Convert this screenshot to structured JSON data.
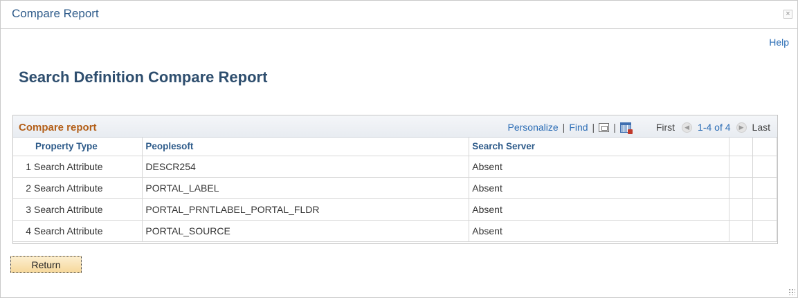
{
  "window": {
    "title": "Compare Report",
    "close_label": "×"
  },
  "help_label": "Help",
  "page_title": "Search Definition Compare Report",
  "grid": {
    "caption": "Compare report",
    "nav": {
      "personalize": "Personalize",
      "find": "Find",
      "first": "First",
      "range": "1-4 of 4",
      "last": "Last",
      "sep": "|"
    },
    "columns": [
      "Property Type",
      "Peoplesoft",
      "Search Server"
    ],
    "rows": [
      {
        "num": "1",
        "property_type": "Search Attribute",
        "peoplesoft": "DESCR254",
        "search_server": "Absent"
      },
      {
        "num": "2",
        "property_type": "Search Attribute",
        "peoplesoft": "PORTAL_LABEL",
        "search_server": "Absent"
      },
      {
        "num": "3",
        "property_type": "Search Attribute",
        "peoplesoft": "PORTAL_PRNTLABEL_PORTAL_FLDR",
        "search_server": "Absent"
      },
      {
        "num": "4",
        "property_type": "Search Attribute",
        "peoplesoft": "PORTAL_SOURCE",
        "search_server": "Absent"
      }
    ]
  },
  "return_label": "Return",
  "icons": {
    "close": "close-icon",
    "new_window": "new-window-icon",
    "download": "spreadsheet-download-icon",
    "prev": "previous-arrow-icon",
    "next": "next-arrow-icon"
  },
  "colors": {
    "title": "#2e5b8a",
    "link": "#2a6cb5",
    "caption": "#b35f18",
    "button": "#f6d89b"
  }
}
